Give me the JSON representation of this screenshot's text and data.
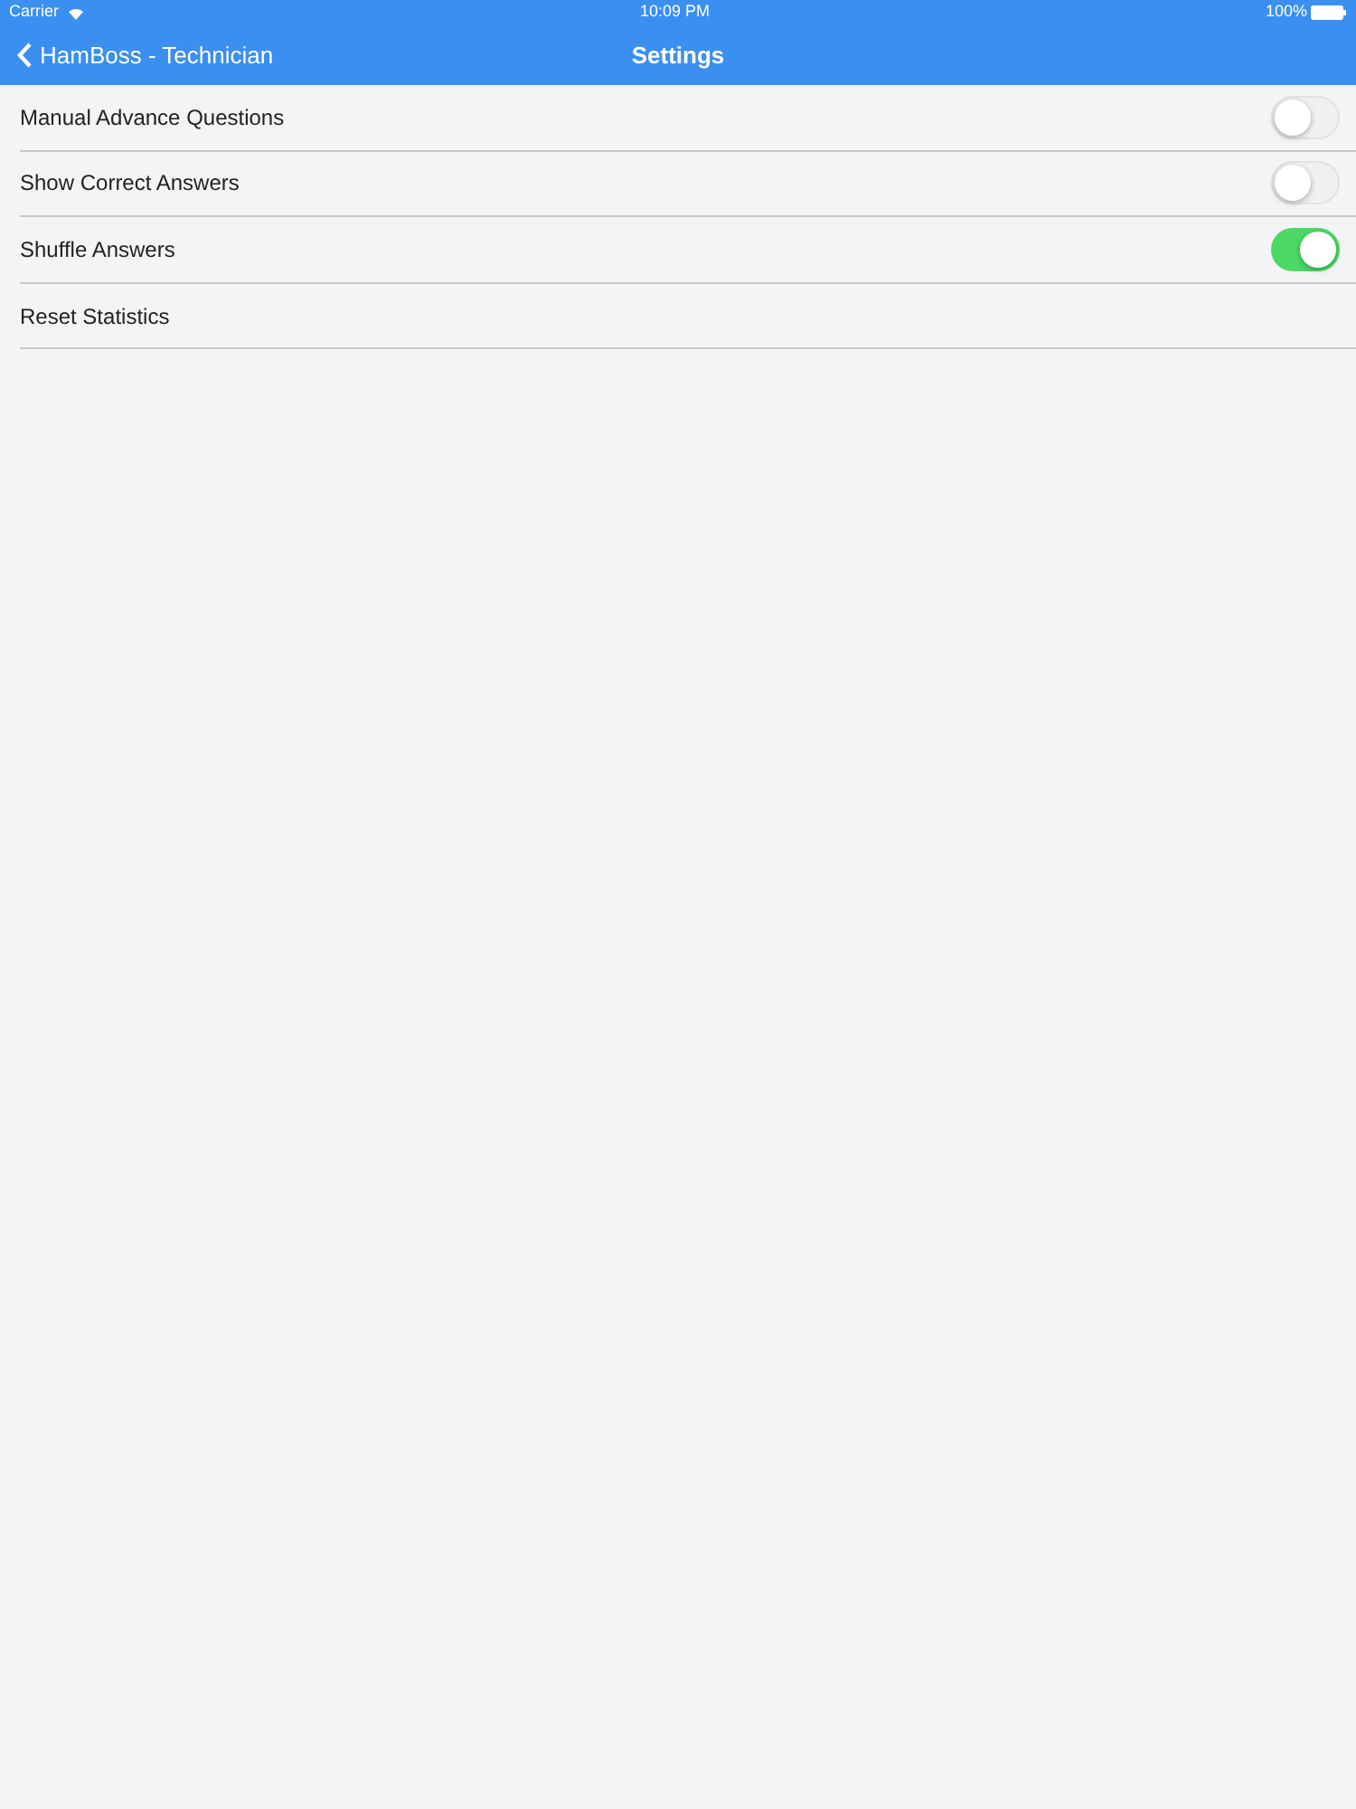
{
  "status_bar": {
    "carrier": "Carrier",
    "time": "10:09 PM",
    "battery": "100%"
  },
  "nav_bar": {
    "back_label": "HamBoss - Technician",
    "title": "Settings"
  },
  "settings": [
    {
      "kind": "toggle",
      "label": "Manual Advance Questions",
      "on": false
    },
    {
      "kind": "toggle",
      "label": "Show Correct Answers",
      "on": false
    },
    {
      "kind": "toggle",
      "label": "Shuffle Answers",
      "on": true
    },
    {
      "kind": "action",
      "label": "Reset Statistics"
    }
  ]
}
